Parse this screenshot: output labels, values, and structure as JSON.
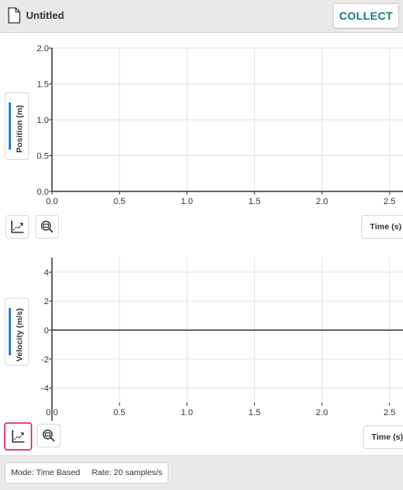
{
  "header": {
    "title": "Untitled",
    "collect_label": "COLLECT"
  },
  "graphs": [
    {
      "y_label": "Position (m)",
      "x_label": "Time (s)",
      "series_color": "#2f7fc6"
    },
    {
      "y_label": "Velocity (m/s)",
      "x_label": "Time (s)",
      "series_color": "#2f7fc6"
    }
  ],
  "footer": {
    "mode": "Mode: Time Based",
    "rate": "Rate: 20 samples/s"
  },
  "chart_data": [
    {
      "type": "line",
      "xlabel": "Time (s)",
      "ylabel": "Position (m)",
      "xlim": [
        0,
        2.6
      ],
      "ylim": [
        0,
        2.0
      ],
      "x_ticks": [
        "0.0",
        "0.5",
        "1.0",
        "1.5",
        "2.0",
        "2.5"
      ],
      "y_ticks": [
        "0.0",
        "0.5",
        "1.0",
        "1.5",
        "2.0"
      ],
      "x_tick_values": [
        0,
        0.5,
        1.0,
        1.5,
        2.0,
        2.5
      ],
      "y_tick_values": [
        0,
        0.5,
        1.0,
        1.5,
        2.0
      ],
      "grid": true,
      "series": []
    },
    {
      "type": "line",
      "xlabel": "Time (s)",
      "ylabel": "Velocity (m/s)",
      "xlim": [
        0,
        2.6
      ],
      "ylim": [
        -5,
        5
      ],
      "x_ticks": [
        "0.0",
        "0.5",
        "1.0",
        "1.5",
        "2.0",
        "2.5"
      ],
      "y_ticks": [
        "4",
        "2",
        "0",
        "-2",
        "-4"
      ],
      "x_tick_values": [
        0,
        0.5,
        1.0,
        1.5,
        2.0,
        2.5
      ],
      "y_tick_values": [
        4,
        2,
        0,
        -2,
        -4
      ],
      "grid": true,
      "series": []
    }
  ]
}
